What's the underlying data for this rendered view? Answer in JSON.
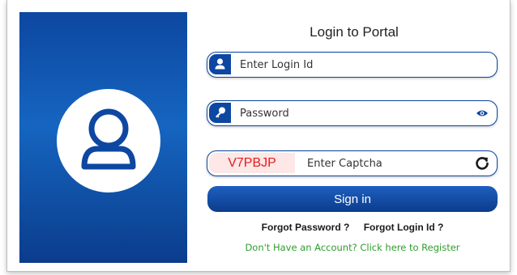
{
  "form": {
    "title": "Login to Portal",
    "login_placeholder": "Enter Login Id",
    "password_placeholder": "Password",
    "captcha_code": "V7PBJP",
    "captcha_placeholder": "Enter Captcha",
    "signin_label": "Sign in",
    "forgot_password": "Forgot Password ?",
    "forgot_login": "Forgot Login Id ?",
    "register": "Don't Have an Account? Click here to Register"
  },
  "icons": {
    "avatar": "user-avatar-icon",
    "login": "user-icon",
    "password": "key-icon",
    "show_password": "eye-icon",
    "refresh": "refresh-icon"
  },
  "colors": {
    "brand": "#0d47a1",
    "captcha_text": "#e21c1c",
    "captcha_bg": "#fde7e7",
    "register_link": "#2e9d2e"
  }
}
